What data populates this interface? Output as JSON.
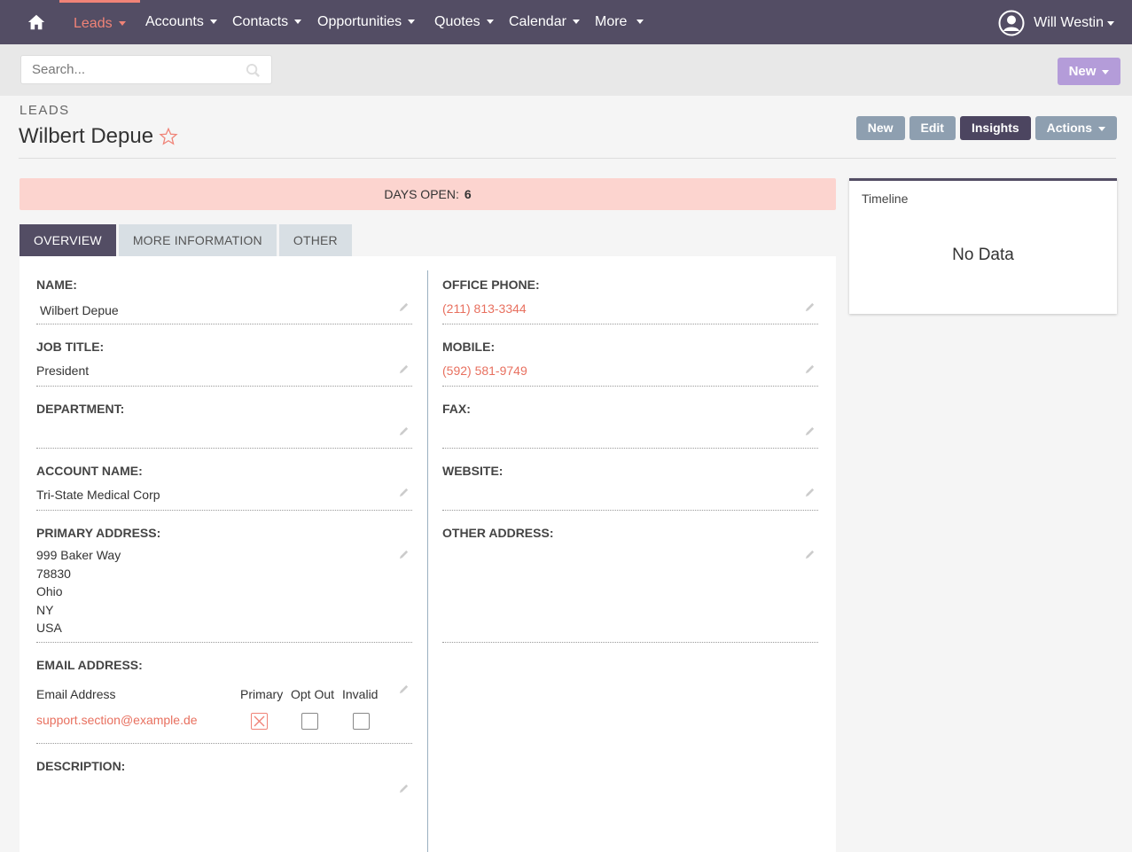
{
  "nav": {
    "items": [
      "Leads",
      "Accounts",
      "Contacts",
      "Opportunities",
      "Quotes",
      "Calendar",
      "More"
    ],
    "user": "Will Westin"
  },
  "search": {
    "placeholder": "Search..."
  },
  "new_top": "New",
  "header": {
    "module": "LEADS",
    "title": "Wilbert Depue",
    "actions": [
      "New",
      "Edit",
      "Insights",
      "Actions"
    ]
  },
  "days_open": {
    "label": "DAYS OPEN:",
    "value": "6"
  },
  "tabs": [
    "OVERVIEW",
    "MORE INFORMATION",
    "OTHER"
  ],
  "fields": {
    "name": {
      "label": "NAME:",
      "value": "Wilbert Depue"
    },
    "job_title": {
      "label": "JOB TITLE:",
      "value": "President"
    },
    "department": {
      "label": "DEPARTMENT:",
      "value": ""
    },
    "account_name": {
      "label": "ACCOUNT NAME:",
      "value": "Tri-State Medical Corp"
    },
    "primary_address": {
      "label": "PRIMARY ADDRESS:",
      "lines": [
        "999 Baker Way",
        "78830",
        "Ohio",
        "NY",
        "USA"
      ]
    },
    "email": {
      "label": "EMAIL ADDRESS:",
      "col_email": "Email Address",
      "col_primary": "Primary",
      "col_optout": "Opt Out",
      "col_invalid": "Invalid",
      "address": "support.section@example.de",
      "primary": true,
      "opt_out": false,
      "invalid": false
    },
    "description": {
      "label": "DESCRIPTION:",
      "value": ""
    },
    "office_phone": {
      "label": "OFFICE PHONE:",
      "value": "(211) 813-3344"
    },
    "mobile": {
      "label": "MOBILE:",
      "value": "(592) 581-9749"
    },
    "fax": {
      "label": "FAX:",
      "value": ""
    },
    "website": {
      "label": "WEBSITE:",
      "value": ""
    },
    "other_address": {
      "label": "OTHER ADDRESS:",
      "value": ""
    }
  },
  "timeline": {
    "title": "Timeline",
    "empty": "No Data"
  }
}
